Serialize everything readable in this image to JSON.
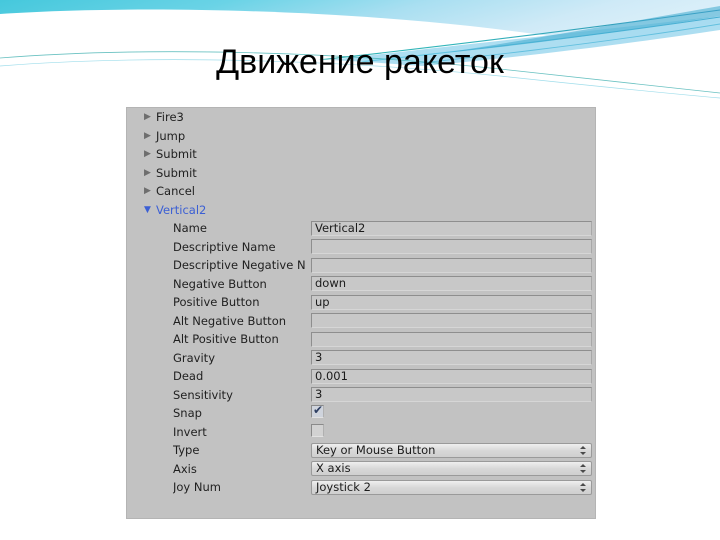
{
  "slide": {
    "title": "Движение ракеток",
    "background_color": "#ffffff",
    "banner": {
      "accent_cyan": "#4fd0e0",
      "accent_blue": "#7fd3ef",
      "accent_teal": "#1f9e9e",
      "accent_light": "#bfe8f5"
    }
  },
  "input_manager": {
    "tree_items": [
      {
        "label": "Fire3",
        "arrow": "triangle-right-icon",
        "expanded": false
      },
      {
        "label": "Jump",
        "arrow": "triangle-right-icon",
        "expanded": false
      },
      {
        "label": "Submit",
        "arrow": "triangle-right-icon",
        "expanded": false
      },
      {
        "label": "Submit",
        "arrow": "triangle-right-icon",
        "expanded": false
      },
      {
        "label": "Cancel",
        "arrow": "triangle-right-icon",
        "expanded": false
      },
      {
        "label": "Vertical2",
        "arrow": "triangle-down-icon",
        "expanded": true
      }
    ],
    "properties": [
      {
        "label": "Name",
        "value": "Vertical2",
        "kind": "text"
      },
      {
        "label": "Descriptive Name",
        "value": "",
        "kind": "text"
      },
      {
        "label": "Descriptive Negative N",
        "value": "",
        "kind": "text"
      },
      {
        "label": "Negative Button",
        "value": "down",
        "kind": "text"
      },
      {
        "label": "Positive Button",
        "value": "up",
        "kind": "text"
      },
      {
        "label": "Alt Negative Button",
        "value": "",
        "kind": "text"
      },
      {
        "label": "Alt Positive Button",
        "value": "",
        "kind": "text"
      },
      {
        "label": "Gravity",
        "value": "3",
        "kind": "text"
      },
      {
        "label": "Dead",
        "value": "0.001",
        "kind": "text"
      },
      {
        "label": "Sensitivity",
        "value": "3",
        "kind": "text"
      },
      {
        "label": "Snap",
        "value": "",
        "kind": "checkbox",
        "checked": true,
        "check_glyph": "✔"
      },
      {
        "label": "Invert",
        "value": "",
        "kind": "checkbox",
        "checked": false,
        "check_glyph": ""
      },
      {
        "label": "Type",
        "value": "Key or Mouse Button",
        "kind": "dropdown"
      },
      {
        "label": "Axis",
        "value": "X axis",
        "kind": "dropdown"
      },
      {
        "label": "Joy Num",
        "value": "Joystick 2",
        "kind": "dropdown"
      }
    ],
    "panel_background_color": "#c2c2c2",
    "field_background_color": "#c8c8c8",
    "expanded_item_color": "#3b5fd4"
  }
}
